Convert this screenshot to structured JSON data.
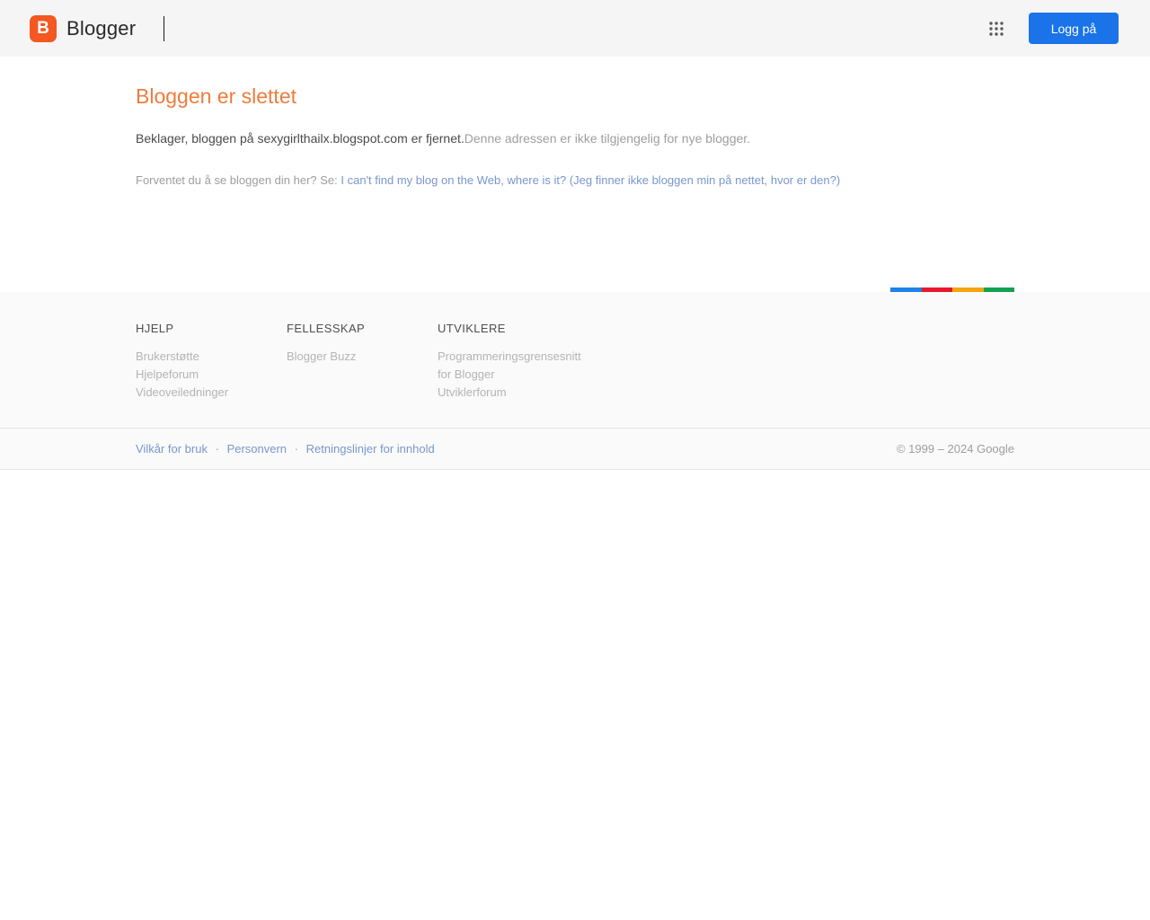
{
  "header": {
    "logo_letter": "B",
    "logo_text": "Blogger",
    "signin_label": "Logg på"
  },
  "main": {
    "title": "Bloggen er slettet",
    "message_primary": "Beklager, bloggen på sexygirlthailx.blogspot.com er fjernet.",
    "message_secondary": "Denne adressen er ikke tilgjengelig for nye blogger.",
    "help_prompt": "Forventet du å se bloggen din her? Se:",
    "help_link_label": "I can't find my blog on the Web, where is it? (Jeg finner ikke bloggen min på nettet, hvor er den?)"
  },
  "footer": {
    "columns": [
      {
        "heading": "HJELP",
        "links": [
          "Brukerstøtte",
          "Hjelpeforum",
          "Videoveiledninger"
        ]
      },
      {
        "heading": "FELLESSKAP",
        "links": [
          "Blogger Buzz"
        ]
      },
      {
        "heading": "UTVIKLERE",
        "links": [
          "Programmeringsgrensesnitt for Blogger",
          "Utviklerforum"
        ]
      }
    ],
    "separator": "·",
    "bottom_links": [
      "Vilkår for bruk",
      "Personvern",
      "Retningslinjer for innhold"
    ],
    "copyright": "© 1999 – 2024 Google",
    "accent_bar_colors": [
      "#2081e8",
      "#e8182f",
      "#f3a60e",
      "#12a054"
    ]
  },
  "icons": {
    "blogger_logo": "blogger-logo-icon",
    "apps_grid": "apps-grid-icon"
  },
  "colors": {
    "brand_orange": "#f4571f",
    "signin_blue": "#1a73e8",
    "title_orange": "#ee7c3b",
    "link_blue": "#7a96cc",
    "header_background": "#f5f5f5",
    "footer_background": "#fafafa"
  }
}
